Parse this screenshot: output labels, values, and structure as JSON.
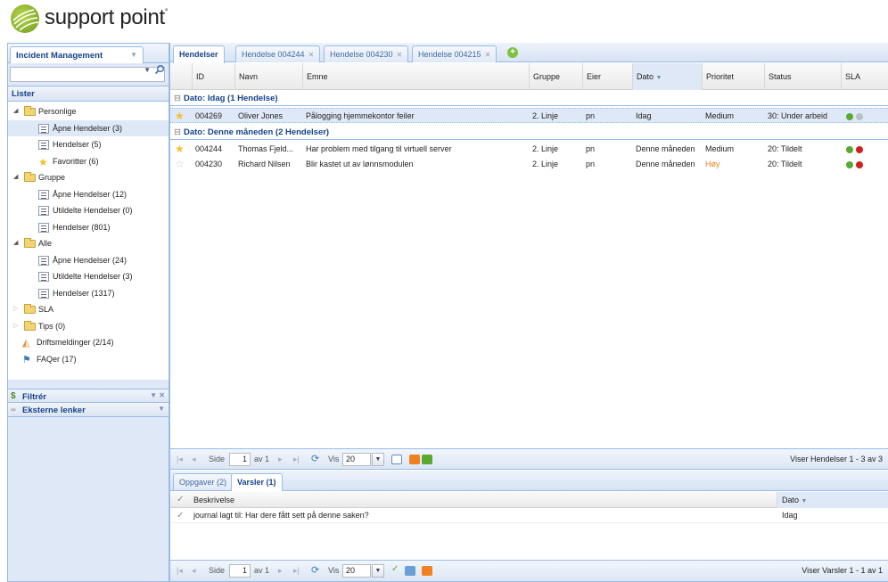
{
  "header": {
    "logo_text": "support point",
    "logo_mark": "°"
  },
  "left_panel": {
    "module_tab": "Incident Management",
    "lister_title": "Lister",
    "tree": [
      {
        "label": "Personlige",
        "type": "folder",
        "level": 0
      },
      {
        "label": "Åpne Hendelser (3)",
        "type": "doc",
        "level": 1,
        "selected": true
      },
      {
        "label": "Hendelser (5)",
        "type": "doc",
        "level": 1
      },
      {
        "label": "Favoritter (6)",
        "type": "star",
        "level": 1
      },
      {
        "label": "Gruppe",
        "type": "folder",
        "level": 0
      },
      {
        "label": "Åpne Hendelser (12)",
        "type": "doc",
        "level": 1
      },
      {
        "label": "Utildelte Hendelser (0)",
        "type": "doc",
        "level": 1
      },
      {
        "label": "Hendelser (801)",
        "type": "doc",
        "level": 1
      },
      {
        "label": "Alle",
        "type": "folder",
        "level": 0
      },
      {
        "label": "Åpne Hendelser (24)",
        "type": "doc",
        "level": 1
      },
      {
        "label": "Utildelte Hendelser (3)",
        "type": "doc",
        "level": 1
      },
      {
        "label": "Hendelser (1317)",
        "type": "doc",
        "level": 1
      },
      {
        "label": "SLA",
        "type": "folder-closed",
        "level": 0
      },
      {
        "label": "Tips (0)",
        "type": "folder-closed",
        "level": 0
      },
      {
        "label": "Driftsmeldinger (2/14)",
        "type": "alert",
        "level": 0
      },
      {
        "label": "FAQer (17)",
        "type": "faq",
        "level": 0
      }
    ],
    "filter_title": "Filtrér",
    "external_links_title": "Eksterne lenker"
  },
  "tabs": [
    {
      "label": "Hendelser",
      "active": true
    },
    {
      "label": "Hendelse 004244"
    },
    {
      "label": "Hendelse 004230"
    },
    {
      "label": "Hendelse 004215"
    }
  ],
  "grid": {
    "columns": [
      "ID",
      "Navn",
      "Emne",
      "Gruppe",
      "Eier",
      "Dato",
      "Prioritet",
      "Status",
      "SLA"
    ],
    "sorted_column": "Dato",
    "groups": [
      {
        "title": "Dato: Idag (1 Hendelse)",
        "rows": [
          {
            "fav": true,
            "id": "004269",
            "navn": "Oliver Jones",
            "emne": "Pålogging hjemmekontor feiler",
            "gruppe": "2. Linje",
            "eier": "pn",
            "dato": "Idag",
            "prioritet": "Medium",
            "status": "30: Under arbeid",
            "sla": [
              "#5aa832",
              "#b8c0c8"
            ],
            "selected": true
          }
        ]
      },
      {
        "title": "Dato: Denne måneden (2 Hendelser)",
        "rows": [
          {
            "fav": true,
            "id": "004244",
            "navn": "Thomas Fjeld...",
            "emne": "Har problem med tilgang til virtuell server",
            "gruppe": "2. Linje",
            "eier": "pn",
            "dato": "Denne måneden",
            "prioritet": "Medium",
            "status": "20: Tildelt",
            "sla": [
              "#5aa832",
              "#d02020"
            ]
          },
          {
            "fav": false,
            "id": "004230",
            "navn": "Richard Nilsen",
            "emne": "Blir kastet ut av lønnsmodulen",
            "gruppe": "2. Linje",
            "eier": "pn",
            "dato": "Denne måneden",
            "prioritet": "Høy",
            "prioritet_color": "#e8801a",
            "status": "20: Tildelt",
            "sla": [
              "#5aa832",
              "#d02020"
            ]
          }
        ]
      }
    ]
  },
  "pager_top": {
    "side_label": "Side",
    "page": "1",
    "of_label": "av 1",
    "vis_label": "Vis",
    "vis_value": "20",
    "summary": "Viser Hendelser 1 - 3 av 3"
  },
  "bottom": {
    "tabs": [
      {
        "label": "Oppgaver (2)"
      },
      {
        "label": "Varsler (1)",
        "active": true
      }
    ],
    "columns": [
      "Beskrivelse",
      "Dato"
    ],
    "rows": [
      {
        "beskrivelse": "journal lagt til: Har dere fått sett på denne saken?",
        "dato": "Idag"
      }
    ],
    "pager": {
      "side_label": "Side",
      "page": "1",
      "of_label": "av 1",
      "vis_label": "Vis",
      "vis_value": "20",
      "summary": "Viser Varsler 1 - 1 av 1"
    }
  },
  "colors": {
    "accent": "#15428b",
    "border": "#99bbe8",
    "panel_bg": "#dfe8f6"
  }
}
